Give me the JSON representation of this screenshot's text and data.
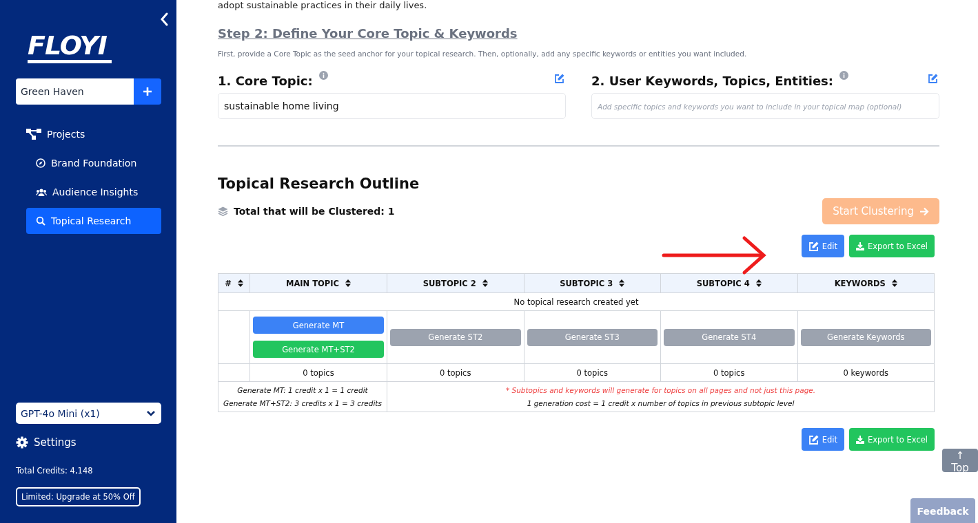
{
  "sidebar": {
    "logo": "FLOYI",
    "project": {
      "value": "Green Haven"
    },
    "nav": [
      {
        "label": "Projects",
        "selected": false,
        "children": [
          {
            "label": "Brand Foundation",
            "selected": false
          },
          {
            "label": "Audience Insights",
            "selected": false
          },
          {
            "label": "Topical Research",
            "selected": true
          }
        ]
      }
    ],
    "model": {
      "value": "GPT-4o Mini (x1)"
    },
    "settings": "Settings",
    "credits": "Total Credits: 4,148",
    "upgrade": "Limited: Upgrade at 50% Off"
  },
  "intro_tail": "adopt sustainable practices in their daily lives.",
  "step": {
    "title": "Step 2: Define Your Core Topic & Keywords",
    "description": "First, provide a Core Topic as the seed anchor for your topical research. Then, optionally, add any specific keywords or entities you want included.",
    "fields": [
      {
        "label": "1. Core Topic:",
        "value": "sustainable home living"
      },
      {
        "label": "2. User Keywords, Topics, Entities:",
        "placeholder": "Add specific topics and keywords you want to include in your topical map (optional)"
      }
    ]
  },
  "outline": {
    "title": "Topical Research Outline",
    "total": "Total that will be Clustered: 1",
    "start_button": {
      "label": "Start Clustering",
      "disabled": true
    },
    "actions": [
      {
        "label": "Edit",
        "kind": "edit"
      },
      {
        "label": "Export to Excel",
        "kind": "export"
      }
    ],
    "table": {
      "columns": [
        "#",
        "MAIN TOPIC",
        "SUBTOPIC 2",
        "SUBTOPIC 3",
        "SUBTOPIC 4",
        "KEYWORDS"
      ],
      "empty_message": "No topical research created yet",
      "generate": [
        [
          {
            "label": "Generate MT",
            "kind": "primary"
          },
          {
            "label": "Generate MT+ST2",
            "kind": "success"
          }
        ],
        [
          {
            "label": "Generate ST2",
            "kind": "muted"
          }
        ],
        [
          {
            "label": "Generate ST3",
            "kind": "muted"
          }
        ],
        [
          {
            "label": "Generate ST4",
            "kind": "muted"
          }
        ],
        [
          {
            "label": "Generate Keywords",
            "kind": "muted"
          }
        ]
      ],
      "counts": [
        "0 topics",
        "0 topics",
        "0 topics",
        "0 topics",
        "0 keywords"
      ],
      "costs": [
        "Generate MT: 1 credit x 1 = 1 credit",
        "Generate MT+ST2: 3 credits x 1 = 3 credits"
      ],
      "notes": [
        {
          "text": "* Subtopics and keywords will generate for topics on all pages and not just this page.",
          "kind": "warning"
        },
        {
          "text": "1 generation cost = 1 credit x number of topics in previous subtopic level",
          "kind": "info"
        }
      ]
    },
    "bottom_actions": [
      {
        "label": "Edit",
        "kind": "edit"
      },
      {
        "label": "Export to Excel",
        "kind": "export"
      }
    ]
  },
  "top_button": "↑ Top",
  "feedback": "Feedback"
}
